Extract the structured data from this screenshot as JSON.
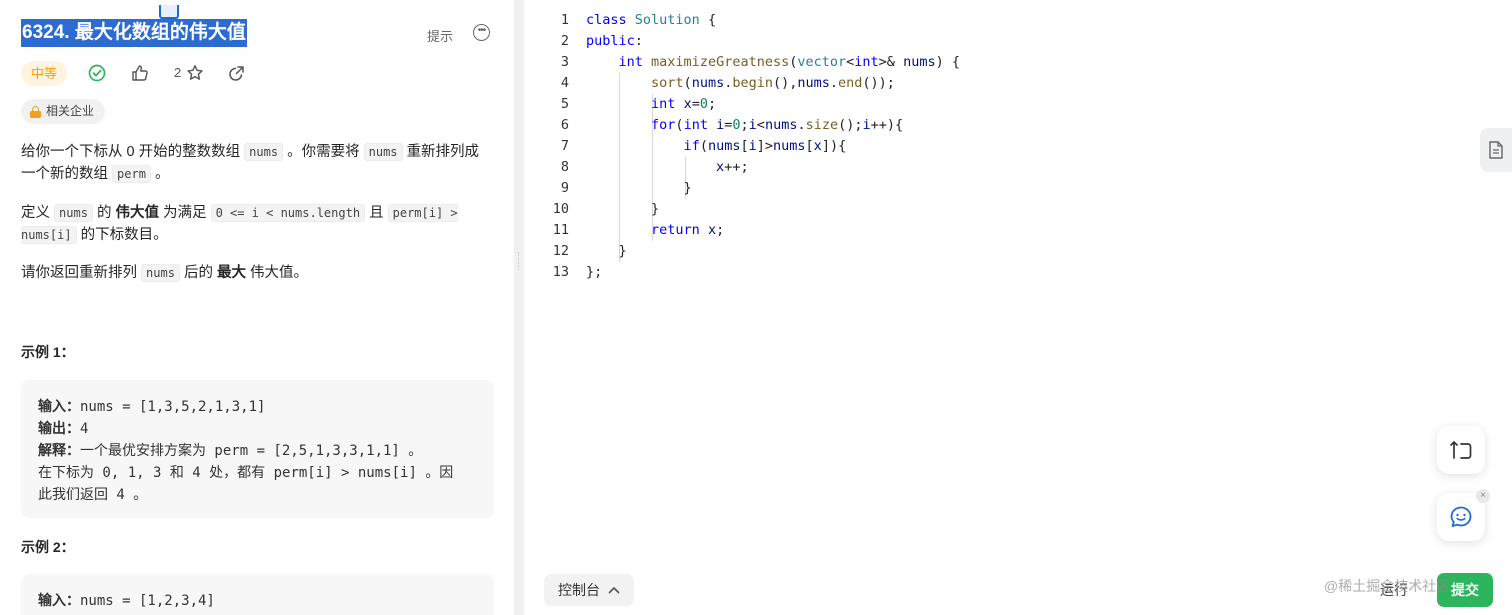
{
  "problem": {
    "title": "6324. 最大化数组的伟大值",
    "hint_label": "提示",
    "difficulty": "中等",
    "likes": "2",
    "company_tag": "相关企业"
  },
  "description": {
    "p1_a": "给你一个下标从 0 开始的整数数组",
    "p1_code1": "nums",
    "p1_b": "。你需要将",
    "p1_code2": "nums",
    "p1_c": "重新排列成一个新的数组",
    "p1_code3": "perm",
    "p1_d": "。",
    "p2_a": "定义",
    "p2_code1": "nums",
    "p2_b": "的",
    "p2_bold": "伟大值",
    "p2_c": "为满足",
    "p2_code2": "0 <= i < nums.length",
    "p2_d": "且",
    "p2_code3": "perm[i] > nums[i]",
    "p2_e": "的下标数目。",
    "p3_a": "请你返回重新排列",
    "p3_code1": "nums",
    "p3_b": "后的",
    "p3_bold": "最大",
    "p3_c": "伟大值。"
  },
  "examples": [
    {
      "title": "示例 1：",
      "input_label": "输入：",
      "input_value": "nums = [1,3,5,2,1,3,1]",
      "output_label": "输出：",
      "output_value": "4",
      "explain_label": "解释：",
      "explain_line1_a": "一个最优安排方案为",
      "explain_line1_code": " perm = [2,5,1,3,3,1,1] ",
      "explain_line1_b": "。",
      "explain_line2_a": "在下标为",
      "explain_line2_code": " 0, 1, 3 ",
      "explain_line2_b": "和",
      "explain_line2_code2": " 4 ",
      "explain_line2_c": "处，都有",
      "explain_line2_code3": " perm[i] > nums[i] ",
      "explain_line2_d": "。因",
      "explain_line3_a": "此我们返回",
      "explain_line3_code": " 4 ",
      "explain_line3_b": "。"
    },
    {
      "title": "示例 2：",
      "input_label": "输入：",
      "input_value": "nums = [1,2,3,4]"
    }
  ],
  "editor": {
    "line_numbers": [
      "1",
      "2",
      "3",
      "4",
      "5",
      "6",
      "7",
      "8",
      "9",
      "10",
      "11",
      "12",
      "13"
    ]
  },
  "toolbar": {
    "console_label": "控制台",
    "run_label": "运行",
    "submit_label": "提交",
    "watermark": "@稀土掘金技术社区"
  },
  "colors": {
    "accent": "#2c6bd2",
    "difficulty_medium": "#ff9f00",
    "submit_green": "#2db55d"
  }
}
